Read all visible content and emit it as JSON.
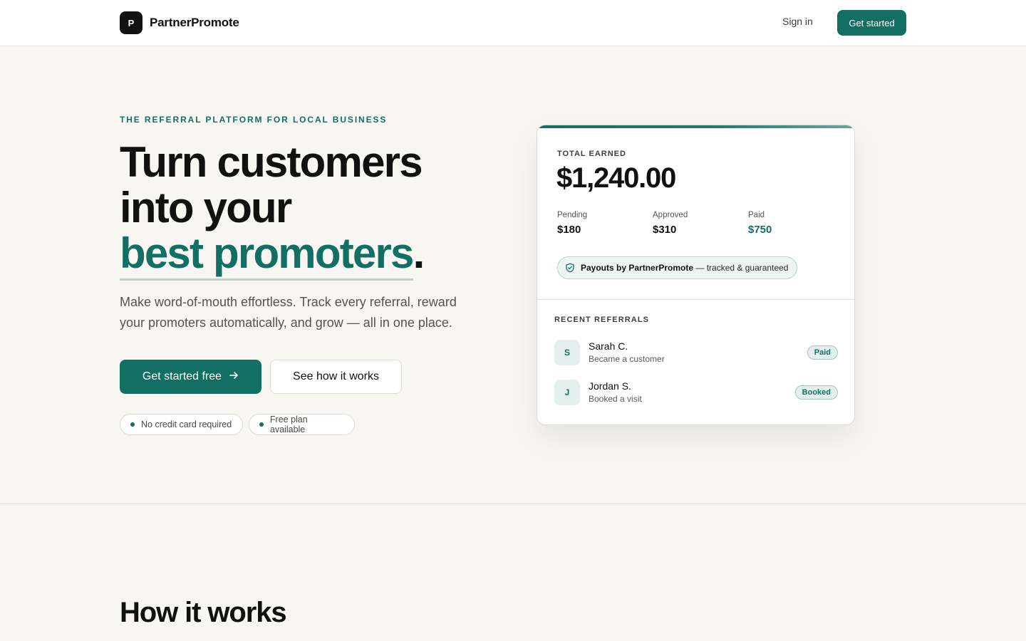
{
  "header": {
    "logo_letter": "P",
    "brand_name": "PartnerPromote",
    "signin_label": "Sign in",
    "cta_label": "Get started"
  },
  "hero": {
    "eyebrow": "THE REFERRAL PLATFORM FOR LOCAL BUSINESS",
    "headline_line1": "Turn customers",
    "headline_line2": "into your",
    "headline_accent": "best promoters",
    "headline_period": ".",
    "subcopy": "Make word-of-mouth effortless. Track every referral, reward your promoters automatically, and grow — all in one place.",
    "primary_cta": "Get started free",
    "primary_cta_icon": "arrow-right-icon",
    "secondary_cta": "See how it works",
    "pills": [
      "No credit card required",
      "Free plan available"
    ]
  },
  "card": {
    "total_label": "TOTAL EARNED",
    "total_value": "$1,240.00",
    "stats": [
      {
        "label": "Pending",
        "value": "$180"
      },
      {
        "label": "Approved",
        "value": "$310"
      },
      {
        "label": "Paid",
        "value": "$750"
      }
    ],
    "payout_strong": "Payouts by PartnerPromote",
    "payout_rest": " — tracked & guaranteed",
    "payout_icon": "shield-check-icon",
    "recent_label": "RECENT REFERRALS",
    "referrals": [
      {
        "initial": "S",
        "name": "Sarah C.",
        "detail": "Became a customer",
        "status": "Paid"
      },
      {
        "initial": "J",
        "name": "Jordan S.",
        "detail": "Booked a visit",
        "status": "Booked"
      }
    ]
  },
  "section": {
    "title": "How it works"
  },
  "colors": {
    "accent": "#136f63",
    "background": "#f7f6f2",
    "text": "#111111"
  }
}
